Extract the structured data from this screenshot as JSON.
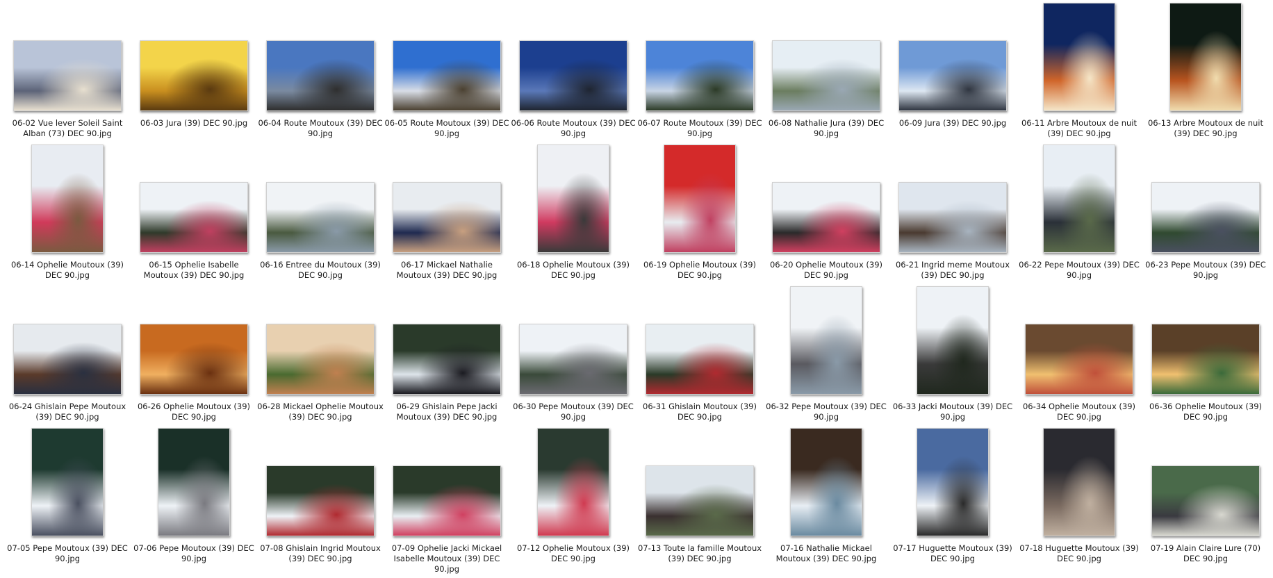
{
  "window": {
    "view": "large-icons"
  },
  "files": [
    {
      "name": "06-02 Vue lever Soleil Saint Alban (73) DEC 90.jpg",
      "thumb": [
        "#b9c4d8",
        "#5c6378",
        "#e8e0d0"
      ],
      "orient": "landscape"
    },
    {
      "name": "06-03 Jura (39) DEC 90.jpg",
      "thumb": [
        "#f3d44a",
        "#c98f1f",
        "#5a3a10"
      ],
      "orient": "landscape"
    },
    {
      "name": "06-04 Route Moutoux (39) DEC 90.jpg",
      "thumb": [
        "#4a77c0",
        "#7a8aa0",
        "#2e2e2e"
      ],
      "orient": "landscape"
    },
    {
      "name": "06-05 Route Moutoux (39) DEC 90.jpg",
      "thumb": [
        "#2f6fd0",
        "#d8dde6",
        "#4a4030"
      ],
      "orient": "landscape"
    },
    {
      "name": "06-06 Route Moutoux (39) DEC 90.jpg",
      "thumb": [
        "#1c3f8f",
        "#5a78b8",
        "#1e2430"
      ],
      "orient": "landscape"
    },
    {
      "name": "06-07 Route Moutoux (39) DEC 90.jpg",
      "thumb": [
        "#4d84d8",
        "#c8d4e4",
        "#2b3a26"
      ],
      "orient": "landscape"
    },
    {
      "name": "06-08 Nathalie Jura (39) DEC 90.jpg",
      "thumb": [
        "#e6eef4",
        "#6b7d60",
        "#9aa8b4"
      ],
      "orient": "landscape"
    },
    {
      "name": "06-09 Jura (39) DEC 90.jpg",
      "thumb": [
        "#6f9ad6",
        "#dde7f2",
        "#2f3540"
      ],
      "orient": "landscape"
    },
    {
      "name": "06-11 Arbre Moutoux de nuit (39) DEC 90.jpg",
      "thumb": [
        "#0f2660",
        "#d0652a",
        "#f5e6c8"
      ],
      "orient": "portrait"
    },
    {
      "name": "06-13 Arbre Moutoux de nuit (39) DEC 90.jpg",
      "thumb": [
        "#0e1a14",
        "#b8541f",
        "#f0dcae"
      ],
      "orient": "portrait"
    },
    {
      "name": "06-14 Ophelie Moutoux (39) DEC 90.jpg",
      "thumb": [
        "#e8ecf2",
        "#d03a5a",
        "#7a5a40"
      ],
      "orient": "portrait"
    },
    {
      "name": "06-15 Ophelie Isabelle Moutoux (39) DEC 90.jpg",
      "thumb": [
        "#eef2f6",
        "#2f3a2a",
        "#c04060"
      ],
      "orient": "landscape"
    },
    {
      "name": "06-16 Entree du Moutoux (39) DEC 90.jpg",
      "thumb": [
        "#f0f3f6",
        "#4a5a40",
        "#8a9aa8"
      ],
      "orient": "landscape"
    },
    {
      "name": "06-17 Mickael Nathalie Moutoux (39) DEC 90.jpg",
      "thumb": [
        "#e8ecf0",
        "#1f2a50",
        "#c8a080"
      ],
      "orient": "landscape"
    },
    {
      "name": "06-18 Ophelie Moutoux (39) DEC 90.jpg",
      "thumb": [
        "#eef0f4",
        "#d03a60",
        "#3a3a3a"
      ],
      "orient": "portrait"
    },
    {
      "name": "06-19 Ophelie Moutoux (39) DEC 90.jpg",
      "thumb": [
        "#d42a2a",
        "#e8ecf0",
        "#c04060"
      ],
      "orient": "portrait"
    },
    {
      "name": "06-20 Ophelie Moutoux (39) DEC 90.jpg",
      "thumb": [
        "#eef2f6",
        "#2a2a2a",
        "#d04060"
      ],
      "orient": "landscape"
    },
    {
      "name": "06-21 Ingrid meme Moutoux (39) DEC 90.jpg",
      "thumb": [
        "#dfe6ee",
        "#4a3a30",
        "#a8b4c0"
      ],
      "orient": "landscape"
    },
    {
      "name": "06-22 Pepe Moutoux (39) DEC 90.jpg",
      "thumb": [
        "#e8eef4",
        "#2a3038",
        "#5a6a4a"
      ],
      "orient": "portrait"
    },
    {
      "name": "06-23 Pepe Moutoux (39) DEC 90.jpg",
      "thumb": [
        "#eef2f6",
        "#304a30",
        "#4a5060"
      ],
      "orient": "landscape"
    },
    {
      "name": "06-24 Ghislain Pepe Moutoux (39) DEC 90.jpg",
      "thumb": [
        "#e6eaee",
        "#5a3a2a",
        "#2a3040"
      ],
      "orient": "landscape"
    },
    {
      "name": "06-26 Ophelie Moutoux (39) DEC 90.jpg",
      "thumb": [
        "#c86a20",
        "#f0b060",
        "#6a3010"
      ],
      "orient": "landscape"
    },
    {
      "name": "06-28 Mickael Ophelie Moutoux (39) DEC 90.jpg",
      "thumb": [
        "#e8d0b0",
        "#4a6a30",
        "#c08050"
      ],
      "orient": "landscape"
    },
    {
      "name": "06-29 Ghislain Pepe Jacki Moutoux (39) DEC 90.jpg",
      "thumb": [
        "#2a3a2a",
        "#dde4ea",
        "#1a1a20"
      ],
      "orient": "landscape"
    },
    {
      "name": "06-30 Pepe Moutoux (39) DEC 90.jpg",
      "thumb": [
        "#eef2f6",
        "#3a4a3a",
        "#6a6a70"
      ],
      "orient": "landscape"
    },
    {
      "name": "06-31 Ghislain Moutoux (39) DEC 90.jpg",
      "thumb": [
        "#e8eef2",
        "#2a3a28",
        "#b02a30"
      ],
      "orient": "landscape"
    },
    {
      "name": "06-32 Pepe Moutoux (39) DEC 90.jpg",
      "thumb": [
        "#f0f3f6",
        "#5a5a60",
        "#8a9aa8"
      ],
      "orient": "portrait"
    },
    {
      "name": "06-33 Jacki Moutoux (39) DEC 90.jpg",
      "thumb": [
        "#eef2f6",
        "#3a3a3a",
        "#20281e"
      ],
      "orient": "portrait"
    },
    {
      "name": "06-34 Ophelie Moutoux (39) DEC 90.jpg",
      "thumb": [
        "#6a4a30",
        "#f0c070",
        "#c0503a"
      ],
      "orient": "landscape"
    },
    {
      "name": "06-36 Ophelie Moutoux (39) DEC 90.jpg",
      "thumb": [
        "#5a4028",
        "#f0c070",
        "#3a6a3a"
      ],
      "orient": "landscape"
    },
    {
      "name": "07-05 Pepe Moutoux (39) DEC 90.jpg",
      "thumb": [
        "#1e3a30",
        "#eef2f6",
        "#4a5060"
      ],
      "orient": "portrait"
    },
    {
      "name": "07-06 Pepe Moutoux (39) DEC 90.jpg",
      "thumb": [
        "#1a3028",
        "#eef2f6",
        "#7a7a80"
      ],
      "orient": "portrait"
    },
    {
      "name": "07-08 Ghislain Ingrid Moutoux (39) DEC 90.jpg",
      "thumb": [
        "#2a3a2a",
        "#eef2f6",
        "#b02a30"
      ],
      "orient": "landscape"
    },
    {
      "name": "07-09 Ophelie Jacki Mickael Isabelle Moutoux (39) DEC 90.jpg",
      "thumb": [
        "#2a3a2a",
        "#e8eef2",
        "#d04060"
      ],
      "orient": "landscape"
    },
    {
      "name": "07-12 Ophelie Moutoux (39) DEC 90.jpg",
      "thumb": [
        "#2a3a30",
        "#eef2f6",
        "#d03a50"
      ],
      "orient": "portrait"
    },
    {
      "name": "07-13 Toute la famille Moutoux (39) DEC 90.jpg",
      "thumb": [
        "#dde4ea",
        "#3a3030",
        "#5a6a4a"
      ],
      "orient": "landscape"
    },
    {
      "name": "07-16 Nathalie Mickael Moutoux (39) DEC 90.jpg",
      "thumb": [
        "#3a2a20",
        "#e8eef4",
        "#6a8aa0"
      ],
      "orient": "portrait"
    },
    {
      "name": "07-17 Huguette Moutoux (39) DEC 90.jpg",
      "thumb": [
        "#4a6aa0",
        "#eef2f6",
        "#2a2a2a"
      ],
      "orient": "portrait"
    },
    {
      "name": "07-18 Huguette Moutoux (39) DEC 90.jpg",
      "thumb": [
        "#2a2a30",
        "#7a6a60",
        "#c0b0a0"
      ],
      "orient": "portrait"
    },
    {
      "name": "07-19 Alain Claire Lure (70) DEC 90.jpg",
      "thumb": [
        "#4a6a4a",
        "#3a3a40",
        "#d8d8d0"
      ],
      "orient": "landscape"
    }
  ]
}
